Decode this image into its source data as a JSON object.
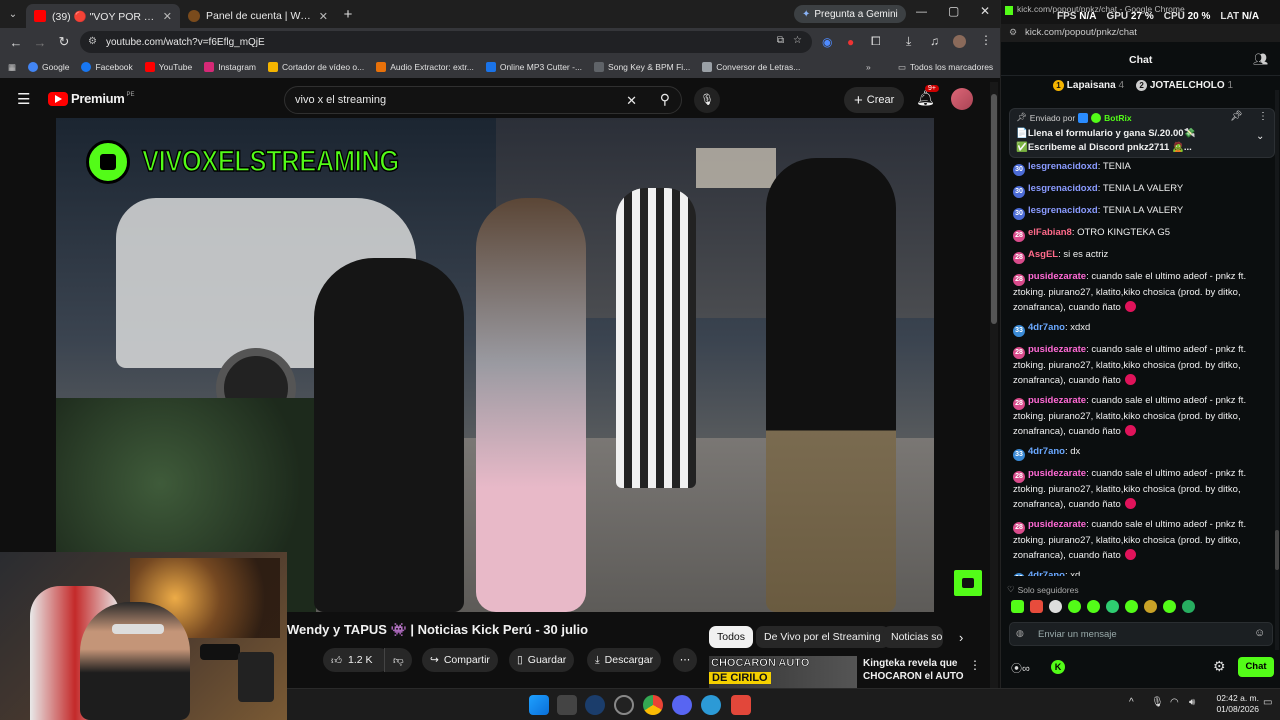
{
  "browser": {
    "tabs": [
      {
        "label": "(39) 🔴 \"VOY POR TI FEKA\"",
        "close": "✕"
      },
      {
        "label": "Panel de cuenta | WoW PerÃº",
        "close": "✕"
      }
    ],
    "gemini_label": "Pregunta a Gemini",
    "url": "youtube.com/watch?v=f6Eflg_mQjE",
    "bookmarks": [
      "Google",
      "Facebook",
      "YouTube",
      "Instagram",
      "Cortador de vídeo o...",
      "Audio Extractor: extr...",
      "Online MP3 Cutter -...",
      "Song Key & BPM Fi...",
      "Conversor de Letras..."
    ],
    "all_bookmarks": "Todos los marcadores"
  },
  "youtube": {
    "logo": "Premium",
    "logo_region": "PE",
    "search_value": "vivo x el streaming",
    "create_label": "Crear",
    "notif_count": "9+",
    "watermark_text": "VIVOXELSTREAMING",
    "video_title": "Wendy y TAPUS 👾 | Noticias Kick Perú - 30 julio",
    "like_count": "1.2 K",
    "share_label": "Compartir",
    "save_label": "Guardar",
    "download_label": "Descargar",
    "chips": [
      "Todos",
      "De Vivo por el Streaming",
      "Noticias so"
    ],
    "suggestion_title": "Kingteka revela que CHOCARON el AUTO ...",
    "suggestion_thumb_text1": "CHOCARON AUTO",
    "suggestion_thumb_text2": "DE CIRILO"
  },
  "chat": {
    "window_title": "kick.com/popout/pnkz/chat - Google Chrome",
    "stats": [
      {
        "k": "FPS",
        "v": "N/A"
      },
      {
        "k": "GPU",
        "v": "27 %"
      },
      {
        "k": "CPU",
        "v": "20 %"
      },
      {
        "k": "LAT",
        "v": "N/A"
      }
    ],
    "url": "kick.com/popout/pnkz/chat",
    "header": "Chat",
    "leaders": [
      {
        "name": "Lapaisana",
        "count": "4",
        "rank": "1"
      },
      {
        "name": "JOTAELCHOLO",
        "count": "1",
        "rank": "2"
      }
    ],
    "pinned_by": "Enviado por",
    "pinned_user": "BotRix",
    "pinned_lines": [
      "📄Llena el formulario y gana S/.20.00💸",
      "✅Escribeme al Discord pnkz2711 🧟..."
    ],
    "messages": [
      {
        "user": "lesgrenacidoxd",
        "color": "#8a9bff",
        "badge": "30",
        "text": "TENIA"
      },
      {
        "user": "lesgrenacidoxd",
        "color": "#8a9bff",
        "badge": "30",
        "text": "TENIA LA VALERY"
      },
      {
        "user": "lesgrenacidoxd",
        "color": "#8a9bff",
        "badge": "30",
        "text": "TENIA LA VALERY"
      },
      {
        "user": "elFabian8",
        "color": "#ff6a8a",
        "badge": "28",
        "text": "OTRO KINGTEKA G5"
      },
      {
        "user": "AsgEL",
        "color": "#ff6a8a",
        "badge": "28",
        "text": "si es actriz"
      },
      {
        "user": "pusidezarate",
        "color": "#ff6ad5",
        "badge": "28",
        "text": "cuando sale el ultimo adeof - pnkz ft. ztoking. piurano27, klatito,kiko chosica (prod. by ditko, zonafranca), cuando ñato"
      },
      {
        "user": "4dr7ano",
        "color": "#6aa8ff",
        "badge": "33",
        "text": "xdxd"
      },
      {
        "user": "pusidezarate",
        "color": "#ff6ad5",
        "badge": "28",
        "text": "cuando sale el ultimo adeof - pnkz ft. ztoking. piurano27, klatito,kiko chosica (prod. by ditko, zonafranca), cuando ñato"
      },
      {
        "user": "pusidezarate",
        "color": "#ff6ad5",
        "badge": "28",
        "text": "cuando sale el ultimo adeof - pnkz ft. ztoking. piurano27, klatito,kiko chosica (prod. by ditko, zonafranca), cuando ñato"
      },
      {
        "user": "4dr7ano",
        "color": "#6aa8ff",
        "badge": "33",
        "text": "dx"
      },
      {
        "user": "pusidezarate",
        "color": "#ff6ad5",
        "badge": "28",
        "text": "cuando sale el ultimo adeof - pnkz ft. ztoking. piurano27, klatito,kiko chosica (prod. by ditko, zonafranca), cuando ñato"
      },
      {
        "user": "pusidezarate",
        "color": "#ff6ad5",
        "badge": "28",
        "text": "cuando sale el ultimo adeof - pnkz ft. ztoking. piurano27, klatito,kiko chosica (prod. by ditko, zonafranca), cuando ñato"
      },
      {
        "user": "4dr7ano",
        "color": "#6aa8ff",
        "badge": "33",
        "text": "xd"
      }
    ],
    "followers_only": "Solo seguidores",
    "input_placeholder": "Enviar un mensaje",
    "chat_button": "Chat",
    "accent": "#53fc18"
  },
  "taskbar": {
    "time": "02:42 a. m.",
    "date": "01/08/2026"
  }
}
